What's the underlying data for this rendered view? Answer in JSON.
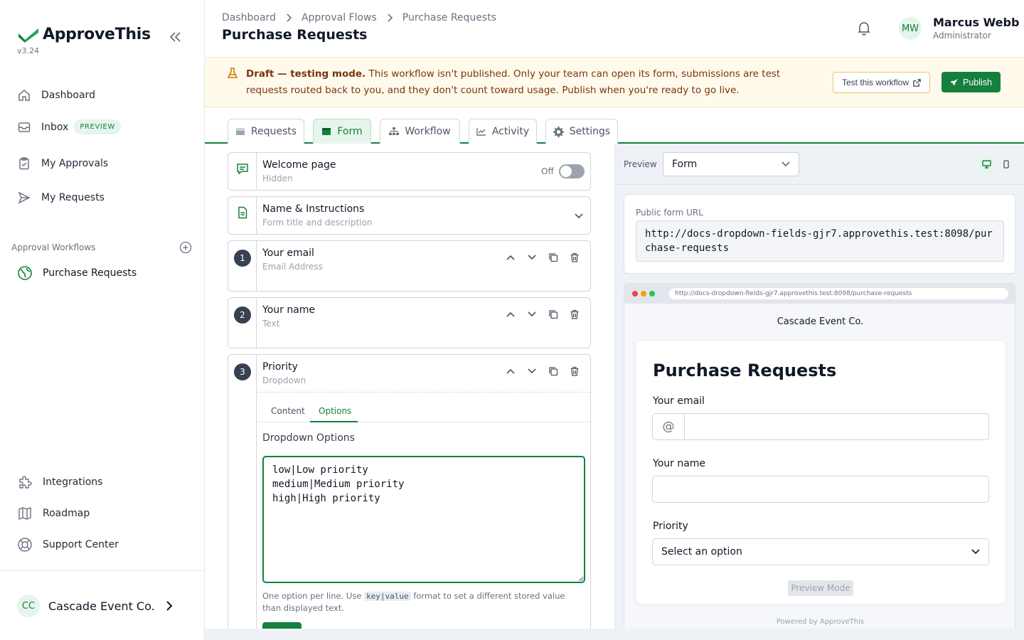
{
  "app": {
    "name": "ApproveThis",
    "version": "v3.24"
  },
  "sidebar": {
    "items": [
      {
        "label": "Dashboard",
        "icon": "home-icon"
      },
      {
        "label": "Inbox",
        "icon": "inbox-icon",
        "badge": "PREVIEW"
      },
      {
        "label": "My Approvals",
        "icon": "clipboard-check-icon"
      },
      {
        "label": "My Requests",
        "icon": "send-icon"
      }
    ],
    "section_label": "Approval Workflows",
    "workflows": [
      {
        "label": "Purchase Requests",
        "icon": "globe-icon"
      }
    ],
    "bottom_items": [
      {
        "label": "Integrations",
        "icon": "puzzle-icon"
      },
      {
        "label": "Roadmap",
        "icon": "map-icon"
      },
      {
        "label": "Support Center",
        "icon": "lifebuoy-icon"
      }
    ],
    "org": {
      "initials": "CC",
      "name": "Cascade Event Co."
    }
  },
  "header": {
    "breadcrumbs": [
      "Dashboard",
      "Approval Flows",
      "Purchase Requests"
    ],
    "title": "Purchase Requests",
    "user": {
      "initials": "MW",
      "name": "Marcus Webb",
      "role": "Administrator"
    }
  },
  "banner": {
    "strong": "Draft — testing mode.",
    "text": " This workflow isn't published. Only your team can open its form, submissions are test requests routed back to you, and they don't count toward usage. Publish when you're ready to go live.",
    "test_button": "Test this workflow",
    "publish_button": "Publish"
  },
  "tabs": [
    "Requests",
    "Form",
    "Workflow",
    "Activity",
    "Settings"
  ],
  "active_tab": "Form",
  "form_editor": {
    "welcome": {
      "title": "Welcome page",
      "subtitle": "Hidden",
      "toggle_label": "Off",
      "enabled": false
    },
    "name_instructions": {
      "title": "Name & Instructions",
      "subtitle": "Form title and description"
    },
    "fields": [
      {
        "number": "1",
        "title": "Your email",
        "type": "Email Address"
      },
      {
        "number": "2",
        "title": "Your name",
        "type": "Text"
      },
      {
        "number": "3",
        "title": "Priority",
        "type": "Dropdown"
      }
    ],
    "subtabs": [
      "Content",
      "Options"
    ],
    "options_label": "Dropdown Options",
    "options_value": "low|Low priority\nmedium|Medium priority\nhigh|High priority",
    "help_before": "One option per line. Use ",
    "help_code": "key|value",
    "help_after": " format to set a different stored value than displayed text."
  },
  "preview": {
    "label": "Preview",
    "mode": "Form",
    "url_label": "Public form URL",
    "url": "http://docs-dropdown-fields-gjr7.approvethis.test:8098/purchase-requests",
    "org_name": "Cascade Event Co.",
    "form_title": "Purchase Requests",
    "fields": [
      {
        "label": "Your email",
        "prefix": "@"
      },
      {
        "label": "Your name"
      },
      {
        "label": "Priority",
        "placeholder": "Select an option"
      }
    ],
    "preview_mode_button": "Preview Mode",
    "powered_by": "Powered by ApproveThis"
  },
  "colors": {
    "brand": "#15803d",
    "banner_bg": "#fffaeb",
    "banner_text": "#78350f"
  }
}
